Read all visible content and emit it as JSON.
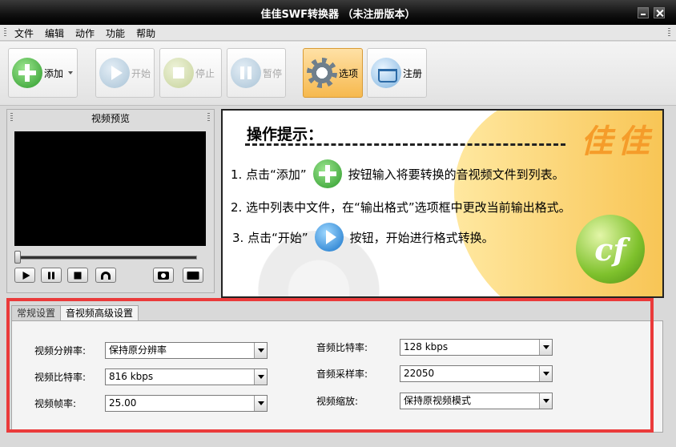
{
  "window": {
    "title": "佳佳SWF转换器 （未注册版本）"
  },
  "menu": {
    "items": [
      "文件",
      "编辑",
      "动作",
      "功能",
      "帮助"
    ]
  },
  "toolbar": {
    "add": "添加",
    "start": "开始",
    "stop": "停止",
    "pause": "暂停",
    "options": "选项",
    "register": "注册"
  },
  "preview": {
    "title": "视频预览"
  },
  "hint": {
    "title": "操作提示：",
    "brand": "佳佳",
    "step1_before": "1. 点击“添加”",
    "step1_after": "按钮输入将要转换的音视频文件到列表。",
    "step2": "2. 选中列表中文件，在“输出格式”选项框中更改当前输出格式。",
    "step3_before": "3. 点击“开始”",
    "step3_after": "按钮，开始进行格式转换。",
    "logo": "cf"
  },
  "tabs": {
    "general": "常规设置",
    "advanced": "音视频高级设置"
  },
  "settings": {
    "video_resolution": {
      "label": "视频分辨率:",
      "value": "保持原分辨率"
    },
    "video_bitrate": {
      "label": "视频比特率:",
      "value": "816 kbps"
    },
    "video_framerate": {
      "label": "视频帧率:",
      "value": "25.00"
    },
    "audio_bitrate": {
      "label": "音频比特率:",
      "value": "128 kbps"
    },
    "audio_samplerate": {
      "label": "音频采样率:",
      "value": "22050"
    },
    "video_scaling": {
      "label": "视频缩放:",
      "value": "保持原视频模式"
    }
  },
  "colors": {
    "highlight_frame": "#ea3a3a",
    "accent_gold": "#f7c04a",
    "brand_orange": "#f59c2a"
  }
}
